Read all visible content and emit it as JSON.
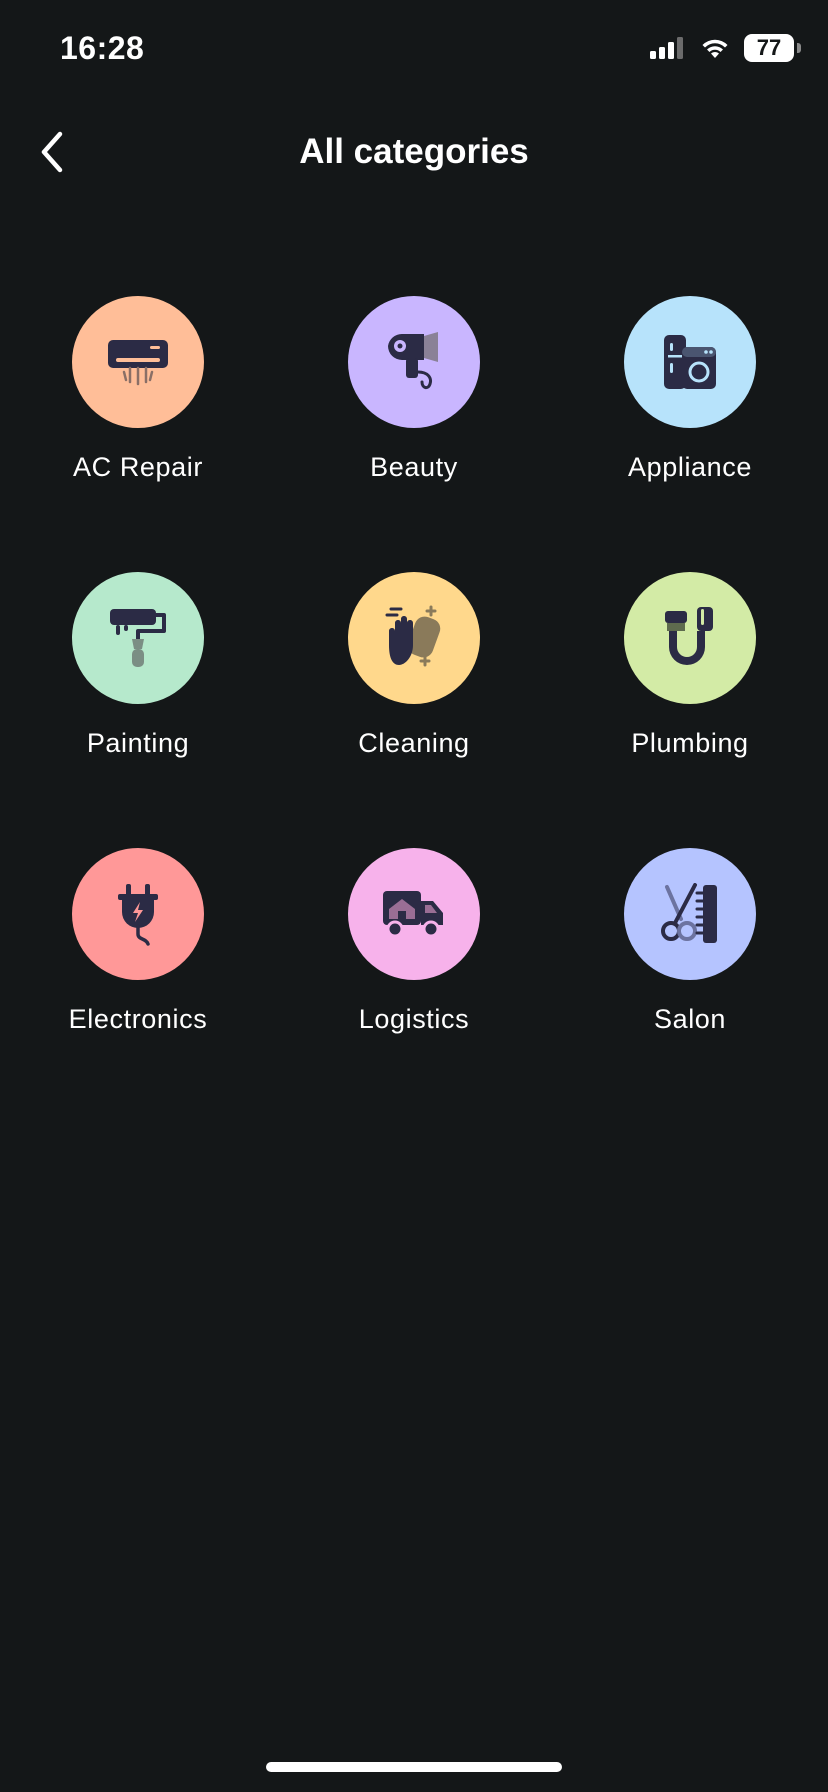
{
  "status_bar": {
    "time": "16:28",
    "battery": "77"
  },
  "header": {
    "title": "All categories"
  },
  "categories": [
    {
      "label": "AC Repair",
      "icon": "ac-unit-icon",
      "color": "#FFBE98"
    },
    {
      "label": "Beauty",
      "icon": "hair-dryer-icon",
      "color": "#C9B6FF"
    },
    {
      "label": "Appliance",
      "icon": "fridge-washer-icon",
      "color": "#B7E3FB"
    },
    {
      "label": "Painting",
      "icon": "paint-roller-icon",
      "color": "#B6E9CC"
    },
    {
      "label": "Cleaning",
      "icon": "cleaning-hand-icon",
      "color": "#FFD88C"
    },
    {
      "label": "Plumbing",
      "icon": "pipe-icon",
      "color": "#D3EBA6"
    },
    {
      "label": "Electronics",
      "icon": "plug-icon",
      "color": "#FF9898"
    },
    {
      "label": "Logistics",
      "icon": "moving-truck-icon",
      "color": "#F7B2EB"
    },
    {
      "label": "Salon",
      "icon": "scissors-comb-icon",
      "color": "#B5C4FF"
    }
  ],
  "colors": {
    "background": "#141718",
    "icon_dark": "#2B2B45",
    "icon_muted": "#8A8197"
  }
}
